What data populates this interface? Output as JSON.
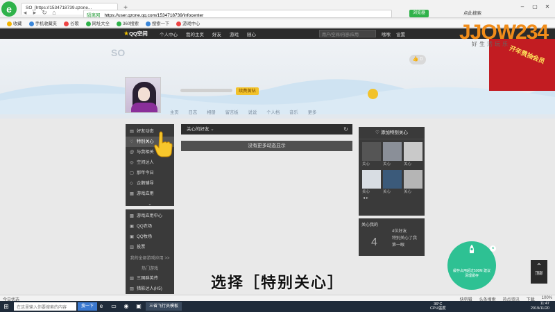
{
  "browser": {
    "tab_title": "SO_[https://1534718739.qzone...",
    "url_safe": "隔离网",
    "url": "https://user.qzone.qq.com/1534718739/infocenter",
    "green_btn": "浏览器",
    "search_right": "点此搜索",
    "bookmarks": [
      "收藏",
      "手机收藏夹",
      "谷歌",
      "网址大全",
      "360搜索",
      "搜索一下",
      "游戏中心"
    ]
  },
  "qqnav": {
    "logo": "QQ空间",
    "items": [
      "个人中心",
      "我的主页",
      "好友",
      "游戏",
      "随心"
    ],
    "search_placeholder": "用户/空间/内容/应用",
    "right": [
      "嗦嗦",
      "设置"
    ]
  },
  "profile": {
    "qzone_logo": "SO",
    "like_count": "0",
    "vip_btn": "续费黄钻",
    "tabs": [
      "主页",
      "日志",
      "相册",
      "留言板",
      "说说",
      "个人档",
      "音乐",
      "更多"
    ]
  },
  "sidebar": {
    "items": [
      {
        "icon": "feed-icon",
        "glyph": "▤",
        "label": "好友动态"
      },
      {
        "icon": "heart-icon",
        "glyph": "♡",
        "label": "特别关心"
      },
      {
        "icon": "at-icon",
        "glyph": "@",
        "label": "与我相关"
      },
      {
        "icon": "visitor-icon",
        "glyph": "◎",
        "label": "空间达人"
      },
      {
        "icon": "calendar-icon",
        "glyph": "▢",
        "label": "那年今日"
      },
      {
        "icon": "helper-icon",
        "glyph": "◇",
        "label": "企鹅辅导"
      },
      {
        "icon": "game-icon",
        "glyph": "▦",
        "label": "游戏应用"
      }
    ],
    "game_items": [
      {
        "icon": "game-center-icon",
        "glyph": "▩",
        "label": "游戏应用中心"
      },
      {
        "icon": "qq-farm-icon",
        "glyph": "▣",
        "label": "QQ农场"
      },
      {
        "icon": "qq-ranch-icon",
        "glyph": "▣",
        "label": "QQ牧场"
      },
      {
        "icon": "stock-icon",
        "glyph": "▥",
        "label": "投票"
      }
    ],
    "all_apps": "我的全部游戏应用 >>",
    "hot_games": "热门游戏",
    "more_games": [
      {
        "icon": "game-a-icon",
        "glyph": "▧",
        "label": "三国群英传"
      },
      {
        "icon": "game-b-icon",
        "glyph": "▨",
        "label": "猎影达人(H5)"
      }
    ]
  },
  "feed": {
    "header": "关心的好友",
    "empty": "没有更多动态显示"
  },
  "special": {
    "header": "添加特别关心",
    "follow_label": "关心",
    "pager_prev": "◂",
    "pager_next": "▸"
  },
  "care_me": {
    "label": "关心我的",
    "count": "4",
    "line1": "4位好友",
    "line2": "特别关心了我",
    "line3": "第一眼"
  },
  "ads": {
    "promo": "开年费抽会员",
    "watermark": "JJOW234",
    "watermark_sub": "好生活玩乐",
    "rocket_text": "缓存占用超过500M 建议清理缓存",
    "back_top": "顶部"
  },
  "caption": "选择［特别关心］",
  "statusbar": {
    "left": "今日优选",
    "right": [
      "快剪辑",
      "头条搜索",
      "热点资讯",
      "下载",
      "100%"
    ]
  },
  "taskbar": {
    "search": "在这里输入你要搜索的内容",
    "btn": "搜一下",
    "app": "三省飞行员模板",
    "tray_temp": "36°C",
    "tray_cpu": "CPU温度",
    "time": "11:47",
    "date": "2019/11/20"
  }
}
